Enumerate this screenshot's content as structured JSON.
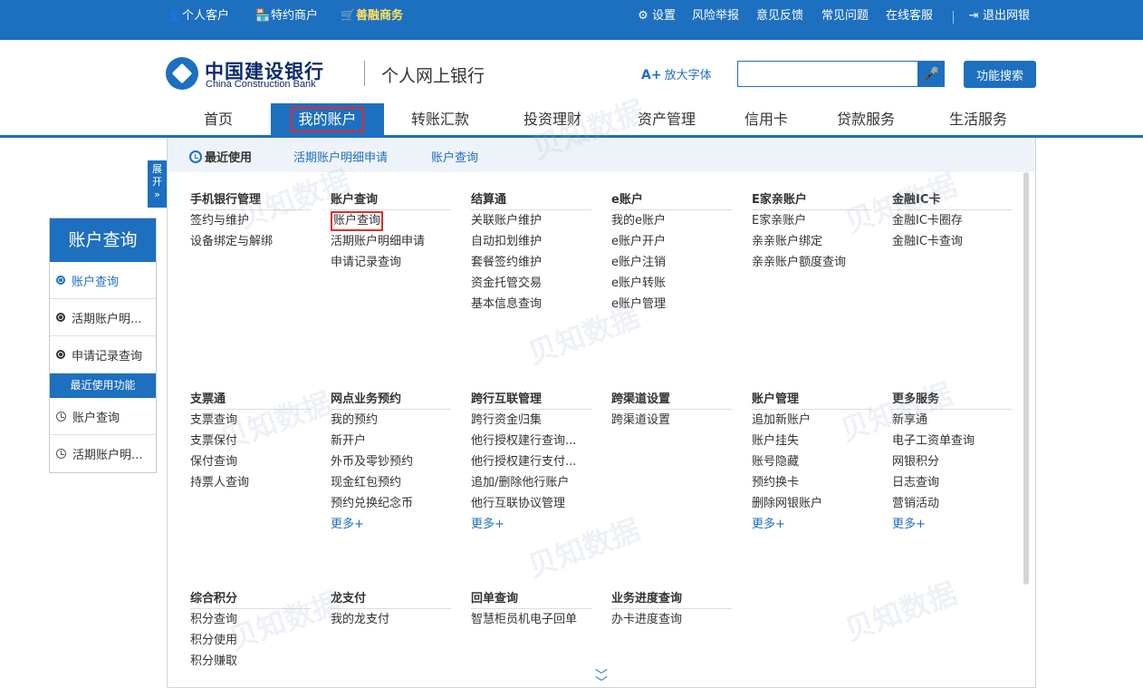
{
  "topbar": {
    "personal": "个人客户",
    "merchant": "特约商户",
    "shanrong": "善融商务",
    "settings": "设置",
    "risk": "风险举报",
    "feedback": "意见反馈",
    "faq": "常见问题",
    "service": "在线客服",
    "logout": "退出网银"
  },
  "header": {
    "bank_cn": "中国建设银行",
    "bank_en": "China Construction Bank",
    "site": "个人网上银行",
    "enlarge": "放大字体",
    "search_placeholder": "",
    "search_button": "功能搜索"
  },
  "nav": [
    "首页",
    "我的账户",
    "转账汇款",
    "投资理财",
    "资产管理",
    "信用卡",
    "贷款服务",
    "生活服务"
  ],
  "expand": "展开",
  "sidebar": {
    "title": "账户查询",
    "items": [
      "账户查询",
      "活期账户明...",
      "申请记录查询"
    ],
    "recent_head": "最近使用功能",
    "recent_items": [
      "账户查询",
      "活期账户明..."
    ]
  },
  "recent_bar": {
    "head": "最近使用",
    "links": [
      "活期账户明细申请",
      "账户查询"
    ]
  },
  "more_label": "更多+",
  "sections": [
    {
      "title": "手机银行管理",
      "items": [
        "签约与维护",
        "设备绑定与解绑"
      ]
    },
    {
      "title": "账户查询",
      "items": [
        "账户查询",
        "活期账户明细申请",
        "申请记录查询"
      ]
    },
    {
      "title": "结算通",
      "items": [
        "关联账户维护",
        "自动扣划维护",
        "套餐签约维护",
        "资金托管交易",
        "基本信息查询"
      ]
    },
    {
      "title": "e账户",
      "items": [
        "我的e账户",
        "e账户开户",
        "e账户注销",
        "e账户转账",
        "e账户管理"
      ]
    },
    {
      "title": "E家亲账户",
      "items": [
        "E家亲账户",
        "亲亲账户绑定",
        "亲亲账户额度查询"
      ]
    },
    {
      "title": "金融IC卡",
      "items": [
        "金融IC卡圈存",
        "金融IC卡查询"
      ]
    },
    {
      "title": "支票通",
      "items": [
        "支票查询",
        "支票保付",
        "保付查询",
        "持票人查询"
      ]
    },
    {
      "title": "网点业务预约",
      "items": [
        "我的预约",
        "新开户",
        "外币及零钞预约",
        "现金红包预约",
        "预约兑换纪念币"
      ]
    },
    {
      "title": "跨行互联管理",
      "items": [
        "跨行资金归集",
        "他行授权建行查询...",
        "他行授权建行支付...",
        "追加/删除他行账户",
        "他行互联协议管理"
      ]
    },
    {
      "title": "跨渠道设置",
      "items": [
        "跨渠道设置"
      ]
    },
    {
      "title": "账户管理",
      "items": [
        "追加新账户",
        "账户挂失",
        "账号隐藏",
        "预约换卡",
        "删除网银账户"
      ]
    },
    {
      "title": "更多服务",
      "items": [
        "新享通",
        "电子工资单查询",
        "网银积分",
        "日志查询",
        "营销活动"
      ]
    },
    {
      "title": "综合积分",
      "items": [
        "积分查询",
        "积分使用",
        "积分赚取"
      ]
    },
    {
      "title": "龙支付",
      "items": [
        "我的龙支付"
      ]
    },
    {
      "title": "回单查询",
      "items": [
        "智慧柜员机电子回单"
      ]
    },
    {
      "title": "业务进度查询",
      "items": [
        "办卡进度查询"
      ]
    }
  ],
  "watermark": "贝知数据"
}
